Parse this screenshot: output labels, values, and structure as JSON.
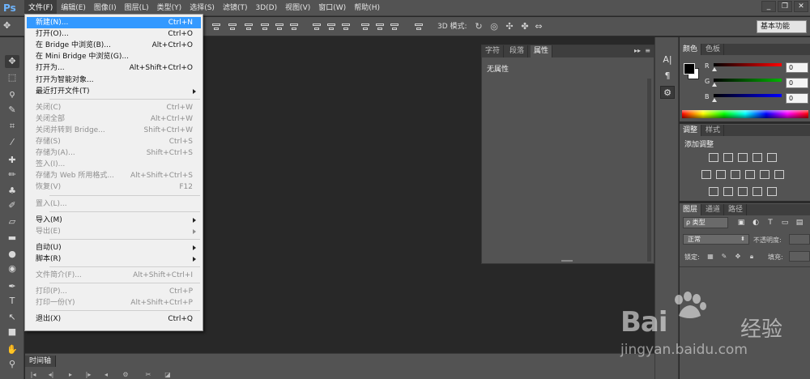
{
  "app": {
    "logo": "Ps"
  },
  "menubar": {
    "items": [
      "文件(F)",
      "编辑(E)",
      "图像(I)",
      "图层(L)",
      "类型(Y)",
      "选择(S)",
      "滤镜(T)",
      "3D(D)",
      "视图(V)",
      "窗口(W)",
      "帮助(H)"
    ],
    "active": "文件(F)",
    "window_controls": [
      "_",
      "❐",
      "✕"
    ]
  },
  "options_bar": {
    "mode3d_label": "3D 模式:",
    "workspace": "基本功能"
  },
  "file_menu": {
    "groups": [
      [
        {
          "label": "新建(N)...",
          "shortcut": "Ctrl+N",
          "highlighted": true
        },
        {
          "label": "打开(O)...",
          "shortcut": "Ctrl+O"
        },
        {
          "label": "在 Bridge 中浏览(B)...",
          "shortcut": "Alt+Ctrl+O"
        },
        {
          "label": "在 Mini Bridge 中浏览(G)...",
          "shortcut": ""
        },
        {
          "label": "打开为...",
          "shortcut": "Alt+Shift+Ctrl+O"
        },
        {
          "label": "打开为智能对象...",
          "shortcut": ""
        },
        {
          "label": "最近打开文件(T)",
          "shortcut": "",
          "submenu": true
        }
      ],
      [
        {
          "label": "关闭(C)",
          "shortcut": "Ctrl+W",
          "disabled": true
        },
        {
          "label": "关闭全部",
          "shortcut": "Alt+Ctrl+W",
          "disabled": true
        },
        {
          "label": "关闭并转到 Bridge...",
          "shortcut": "Shift+Ctrl+W",
          "disabled": true
        },
        {
          "label": "存储(S)",
          "shortcut": "Ctrl+S",
          "disabled": true
        },
        {
          "label": "存储为(A)...",
          "shortcut": "Shift+Ctrl+S",
          "disabled": true
        },
        {
          "label": "签入(I)...",
          "shortcut": "",
          "disabled": true
        },
        {
          "label": "存储为 Web 所用格式...",
          "shortcut": "Alt+Shift+Ctrl+S",
          "disabled": true
        },
        {
          "label": "恢复(V)",
          "shortcut": "F12",
          "disabled": true
        }
      ],
      [
        {
          "label": "置入(L)...",
          "shortcut": "",
          "disabled": true
        }
      ],
      [
        {
          "label": "导入(M)",
          "shortcut": "",
          "submenu": true
        },
        {
          "label": "导出(E)",
          "shortcut": "",
          "submenu": true,
          "disabled": true
        }
      ],
      [
        {
          "label": "自动(U)",
          "shortcut": "",
          "submenu": true
        },
        {
          "label": "脚本(R)",
          "shortcut": "",
          "submenu": true
        }
      ],
      [
        {
          "label": "文件简介(F)...",
          "shortcut": "Alt+Shift+Ctrl+I",
          "disabled": true
        }
      ],
      [
        {
          "label": "打印(P)...",
          "shortcut": "Ctrl+P",
          "disabled": true
        },
        {
          "label": "打印一份(Y)",
          "shortcut": "Alt+Shift+Ctrl+P",
          "disabled": true
        }
      ],
      [
        {
          "label": "退出(X)",
          "shortcut": "Ctrl+Q"
        }
      ]
    ]
  },
  "properties_panel": {
    "tabs": [
      "字符",
      "段落",
      "属性"
    ],
    "active_tab": "属性",
    "collapse": "▸▸",
    "menu": "≡",
    "empty_text": "无属性"
  },
  "color_panel": {
    "tabs": [
      "颜色",
      "色板"
    ],
    "active_tab": "颜色",
    "channels": [
      {
        "name": "R",
        "value": "0",
        "color": "#ff0000"
      },
      {
        "name": "G",
        "value": "0",
        "color": "#00b400"
      },
      {
        "name": "B",
        "value": "0",
        "color": "#0000ff"
      }
    ],
    "foreground": "#000000",
    "background": "#ffffff"
  },
  "adjustments_panel": {
    "tabs": [
      "调整",
      "样式"
    ],
    "active_tab": "调整",
    "title": "添加调整"
  },
  "layers_panel": {
    "tabs": [
      "图层",
      "通道",
      "路径"
    ],
    "active_tab": "图层",
    "kind_filter": "ρ 类型",
    "blend_mode": "正常",
    "opacity_label": "不透明度:",
    "lock_label": "锁定:",
    "fill_label": "填充:"
  },
  "timeline": {
    "tab": "时间轴"
  },
  "watermark": {
    "brand": "Bai",
    "brand_end": "经验",
    "url": "jingyan.baidu.com"
  }
}
